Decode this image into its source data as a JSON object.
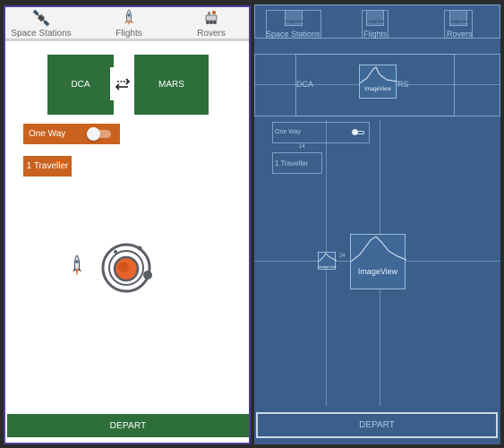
{
  "tabs": [
    {
      "label": "Space Stations",
      "icon": "satellite-icon"
    },
    {
      "label": "Flights",
      "icon": "rocket-icon"
    },
    {
      "label": "Rovers",
      "icon": "rover-icon"
    }
  ],
  "route": {
    "from": "DCA",
    "to": "MARS",
    "swap_icon": "swap-arrows-icon"
  },
  "trip": {
    "one_way_label": "One Way",
    "one_way_enabled": false
  },
  "travellers": {
    "label": "1 Traveller"
  },
  "depart": {
    "label": "DEPART"
  },
  "blueprint": {
    "route_from": "DCA",
    "route_to_partial": "RS",
    "imageview_label": "ImageView",
    "oneway_label": "One Way",
    "traveller_label": "1 Traveller",
    "depart_label": "DEPART",
    "margin_a": "14",
    "margin_b": "24",
    "imageview_small": "ImageView"
  },
  "colors": {
    "green": "#2e6e3a",
    "orange": "#c9621e",
    "blueprint_bg": "#3b5f8a",
    "accent_orange": "#e8642a"
  }
}
